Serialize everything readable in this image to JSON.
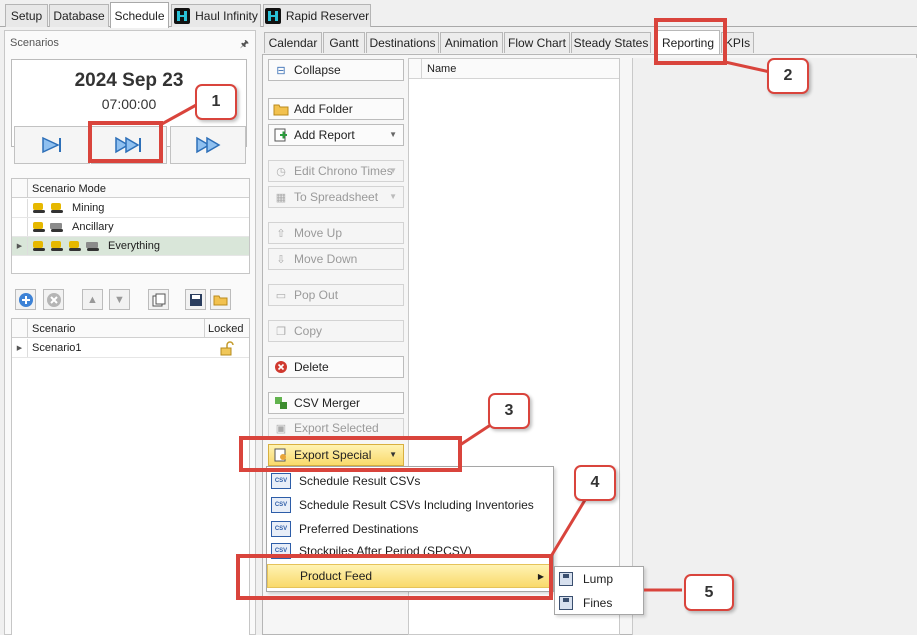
{
  "top_tabs": [
    {
      "label": "Setup"
    },
    {
      "label": "Database"
    },
    {
      "label": "Schedule"
    },
    {
      "label": "Haul Infinity"
    },
    {
      "label": "Rapid Reserver"
    }
  ],
  "left_panel": {
    "title": "Scenarios",
    "date": "2024 Sep 23",
    "time": "07:00:00",
    "mode_grid": {
      "header": "Scenario Mode",
      "rows": [
        {
          "label": "Mining"
        },
        {
          "label": "Ancillary"
        },
        {
          "label": "Everything"
        }
      ]
    },
    "scenario_grid": {
      "header_scenario": "Scenario",
      "header_locked": "Locked",
      "rows": [
        {
          "label": "Scenario1"
        }
      ]
    }
  },
  "sub_tabs": [
    {
      "label": "Calendar"
    },
    {
      "label": "Gantt"
    },
    {
      "label": "Destinations"
    },
    {
      "label": "Animation"
    },
    {
      "label": "Flow Chart"
    },
    {
      "label": "Steady States"
    },
    {
      "label": "Reporting"
    },
    {
      "label": "KPIs"
    }
  ],
  "actions": {
    "collapse": "Collapse",
    "add_folder": "Add Folder",
    "add_report": "Add Report",
    "edit_chrono": "Edit Chrono Times",
    "to_spreadsheet": "To Spreadsheet",
    "move_up": "Move Up",
    "move_down": "Move Down",
    "pop_out": "Pop Out",
    "copy": "Copy",
    "delete": "Delete",
    "csv_merger": "CSV Merger",
    "export_selected": "Export Selected",
    "export_special": "Export Special"
  },
  "name_column": "Name",
  "export_menu": [
    {
      "label": "Schedule Result CSVs"
    },
    {
      "label": "Schedule Result CSVs Including Inventories"
    },
    {
      "label": "Preferred Destinations"
    },
    {
      "label": "Stockpiles After Period (SPCSV)"
    },
    {
      "label": "Product Feed"
    }
  ],
  "product_feed_submenu": [
    {
      "label": "Lump"
    },
    {
      "label": "Fines"
    }
  ],
  "callouts": [
    "1",
    "2",
    "3",
    "4",
    "5"
  ],
  "colors": {
    "callout": "#d9443c",
    "highlight": "#f9d96b",
    "selected_row": "#d9e6d9"
  }
}
